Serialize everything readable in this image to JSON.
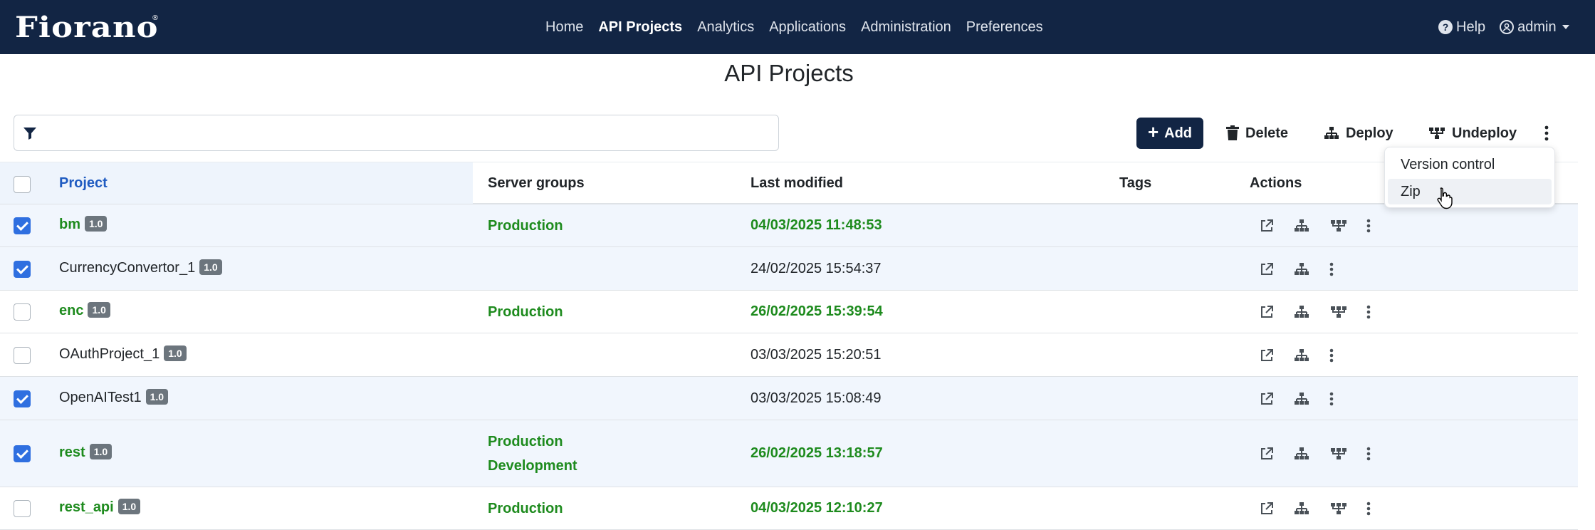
{
  "brand": {
    "name": "Fiorano",
    "trademark": "®"
  },
  "nav": {
    "items": [
      {
        "label": "Home",
        "active": false
      },
      {
        "label": "API Projects",
        "active": true
      },
      {
        "label": "Analytics",
        "active": false
      },
      {
        "label": "Applications",
        "active": false
      },
      {
        "label": "Administration",
        "active": false
      },
      {
        "label": "Preferences",
        "active": false
      }
    ],
    "help_label": "Help",
    "user_label": "admin"
  },
  "page": {
    "title": "API Projects"
  },
  "filter": {
    "placeholder": "",
    "value": ""
  },
  "toolbar": {
    "add_label": "Add",
    "delete_label": "Delete",
    "deploy_label": "Deploy",
    "undeploy_label": "Undeploy"
  },
  "more_menu": {
    "items": [
      "Version control",
      "Zip"
    ],
    "hovered": "Zip"
  },
  "table": {
    "columns": [
      "Project",
      "Server groups",
      "Last modified",
      "Tags",
      "Actions"
    ],
    "sorted_column": "Project",
    "rows": [
      {
        "name": "bm",
        "version": "1.0",
        "server_groups": [
          "Production"
        ],
        "last_modified": "04/03/2025 11:48:53",
        "tags": "",
        "deployed": true,
        "checked": true
      },
      {
        "name": "CurrencyConvertor_1",
        "version": "1.0",
        "server_groups": [],
        "last_modified": "24/02/2025 15:54:37",
        "tags": "",
        "deployed": false,
        "checked": true
      },
      {
        "name": "enc",
        "version": "1.0",
        "server_groups": [
          "Production"
        ],
        "last_modified": "26/02/2025 15:39:54",
        "tags": "",
        "deployed": true,
        "checked": false
      },
      {
        "name": "OAuthProject_1",
        "version": "1.0",
        "server_groups": [],
        "last_modified": "03/03/2025 15:20:51",
        "tags": "",
        "deployed": false,
        "checked": false
      },
      {
        "name": "OpenAITest1",
        "version": "1.0",
        "server_groups": [],
        "last_modified": "03/03/2025 15:08:49",
        "tags": "",
        "deployed": false,
        "checked": true
      },
      {
        "name": "rest",
        "version": "1.0",
        "server_groups": [
          "Production",
          "Development"
        ],
        "last_modified": "26/02/2025 13:18:57",
        "tags": "",
        "deployed": true,
        "checked": true
      },
      {
        "name": "rest_api",
        "version": "1.0",
        "server_groups": [
          "Production"
        ],
        "last_modified": "04/03/2025 12:10:27",
        "tags": "",
        "deployed": true,
        "checked": false
      }
    ]
  },
  "colors": {
    "navbar": "#122544",
    "deployed_text": "#1e8b1e",
    "checkbox": "#2f6fe0",
    "sorted_header": "#1f5bc1"
  },
  "icons": [
    "filter-icon",
    "plus-icon",
    "trash-icon",
    "deploy-icon",
    "undeploy-icon",
    "kebab-icon",
    "open-external-icon",
    "help-icon",
    "user-icon"
  ]
}
